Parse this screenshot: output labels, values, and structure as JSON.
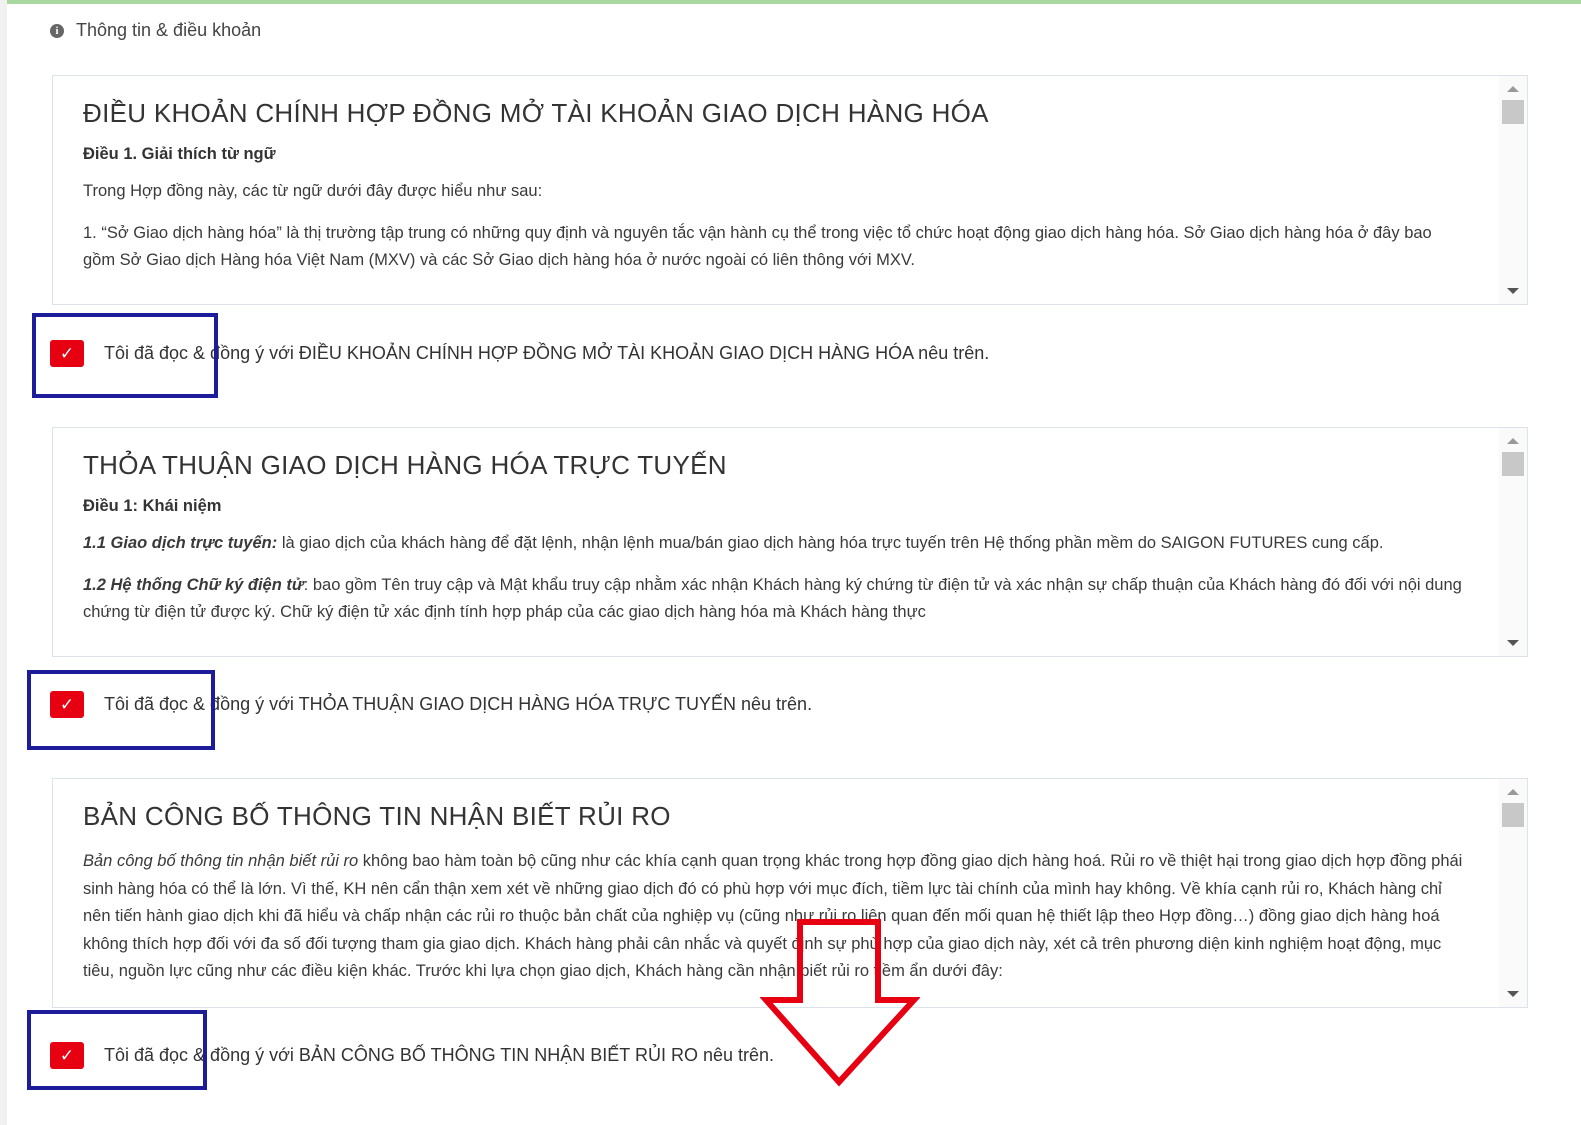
{
  "section": {
    "title": "Thông tin & điều khoản",
    "icon": "info-icon"
  },
  "terms": [
    {
      "title": "ĐIỀU KHOẢN CHÍNH HỢP ĐỒNG MỞ TÀI KHOẢN GIAO DỊCH HÀNG HÓA",
      "heading": "Điều 1. Giải thích từ ngữ",
      "p1": "Trong Hợp đồng này, các từ ngữ dưới đây được hiểu như sau:",
      "p2": "1. “Sở Giao dịch hàng hóa” là thị trường tập trung có những quy định và nguyên tắc vận hành cụ thể trong việc tổ chức hoạt động giao dịch hàng hóa. Sở Giao dịch hàng hóa ở đây bao gồm Sở Giao dịch Hàng hóa Việt Nam (MXV) và các Sở Giao dịch hàng hóa ở nước ngoài có liên thông với MXV.",
      "agree_label": "Tôi đã đọc & đồng ý với ĐIỀU KHOẢN CHÍNH HỢP ĐỒNG MỞ TÀI KHOẢN GIAO DỊCH HÀNG HÓA nêu trên.",
      "checked": true
    },
    {
      "title": "THỎA THUẬN GIAO DỊCH HÀNG HÓA TRỰC TUYẾN",
      "heading": "Điều 1: Khái niệm",
      "p1_em": "1.1 Giao dịch trực tuyến:",
      "p1": " là giao dịch của khách hàng để đặt lệnh, nhận lệnh mua/bán giao dịch hàng hóa trực tuyến trên Hệ thống phần mềm do SAIGON FUTURES cung cấp.",
      "p2_em": "1.2 Hệ thống Chữ ký điện tử",
      "p2": ": bao gồm Tên truy cập và Mật khẩu truy cập nhằm xác nhận Khách hàng ký chứng từ điện tử và xác nhận sự chấp thuận của Khách hàng đó đối với nội dung chứng từ điện tử được ký. Chữ ký điện tử xác định tính hợp pháp của các giao dịch hàng hóa mà Khách hàng thực",
      "agree_label": "Tôi đã đọc & đồng ý với THỎA THUẬN GIAO DỊCH HÀNG HÓA TRỰC TUYẾN nêu trên.",
      "checked": true
    },
    {
      "title": "BẢN CÔNG BỐ THÔNG TIN NHẬN BIẾT RỦI RO",
      "p1_em": "Bản công bố thông tin nhận biết rủi ro",
      "p1": " không bao hàm toàn bộ cũng như các khía cạnh quan trọng khác trong hợp đồng giao dịch hàng hoá. Rủi ro về thiệt hại trong giao dịch hợp đồng phái sinh hàng hóa có thể là lớn. Vì thế, KH nên cẩn thận xem xét về những giao dịch đó có phù hợp với mục đích, tiềm lực tài chính của mình hay không. Về khía cạnh rủi ro, Khách hàng chỉ nên tiến hành giao dịch khi đã hiểu và chấp nhận các rủi ro thuộc bản chất của nghiệp vụ (cũng như rủi ro liên quan đến mối quan hệ thiết lập theo Hợp đồng…) đồng giao dịch hàng hoá không thích hợp đối với đa số đối tượng tham gia giao dịch. Khách hàng phải cân nhắc và quyết định sự phù hợp của giao dịch này, xét cả trên phương diện kinh nghiệm hoạt động, mục tiêu, nguồn lực cũng như các điều kiện khác. Trước khi lựa chọn giao dịch, Khách hàng cần nhận biết rủi ro tiềm ẩn dưới đây:",
      "agree_label": "Tôi đã đọc & đồng ý với BẢN CÔNG BỐ THÔNG TIN NHẬN BIẾT RỦI RO nêu trên.",
      "checked": true
    }
  ],
  "check_glyph": "✓",
  "colors": {
    "checkbox": "#e60012",
    "highlight_box": "#1d1d9c",
    "arrow": "#e60012"
  }
}
